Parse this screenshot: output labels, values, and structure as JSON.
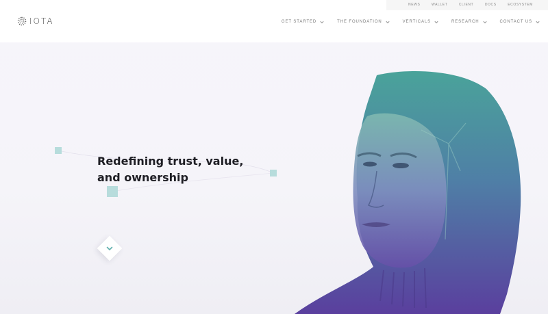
{
  "brand": {
    "name": "IOTA",
    "logo_icon": "iota-logo-icon"
  },
  "topbar": {
    "items": [
      {
        "label": "NEWS"
      },
      {
        "label": "WALLET"
      },
      {
        "label": "CLIENT"
      },
      {
        "label": "DOCS"
      },
      {
        "label": "ECOSYSTEM"
      }
    ]
  },
  "nav": {
    "items": [
      {
        "label": "GET STARTED",
        "icon": "chevron-down-icon"
      },
      {
        "label": "THE FOUNDATION",
        "icon": "chevron-down-icon"
      },
      {
        "label": "VERTICALS",
        "icon": "chevron-down-icon"
      },
      {
        "label": "RESEARCH",
        "icon": "chevron-down-icon"
      },
      {
        "label": "CONTACT US",
        "icon": "chevron-down-icon"
      }
    ]
  },
  "hero": {
    "headline_line1": "Redefining trust, value,",
    "headline_line2": "and ownership",
    "scroll_icon": "chevron-down-icon",
    "accent_color": "#b7dcdc",
    "portrait_gradient": [
      "#4aa39a",
      "#4f7fa6",
      "#5a3f9e"
    ]
  }
}
